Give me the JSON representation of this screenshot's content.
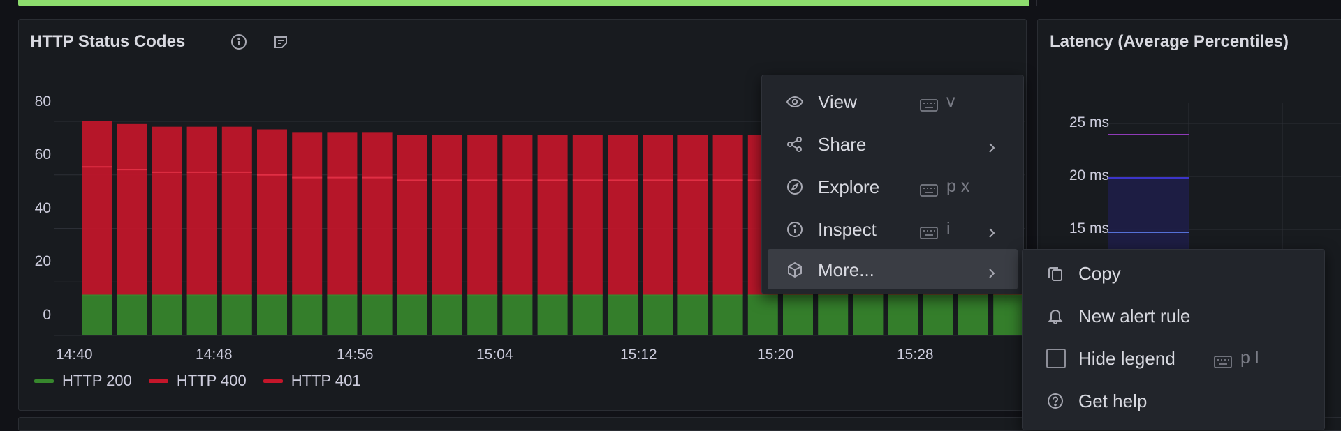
{
  "status_panel": {
    "title": "HTTP Status Codes",
    "info_icon": "info-circle-icon",
    "notes_icon": "note-icon",
    "y_ticks": [
      "80",
      "60",
      "40",
      "20",
      "0"
    ],
    "x_ticks": [
      "14:40",
      "14:48",
      "14:56",
      "15:04",
      "15:12",
      "15:20",
      "15:28"
    ],
    "legend": [
      {
        "label": "HTTP 200",
        "color": "#37872d"
      },
      {
        "label": "HTTP 400",
        "color": "#c4162a"
      },
      {
        "label": "HTTP 401",
        "color": "#c4162a"
      }
    ]
  },
  "latency_panel": {
    "title": "Latency (Average Percentiles)",
    "y_ticks": [
      "25 ms",
      "20 ms",
      "15 ms"
    ]
  },
  "context_menu": {
    "items": [
      {
        "label": "View",
        "icon": "eye-icon",
        "shortcut": "v",
        "submenu": false
      },
      {
        "label": "Share",
        "icon": "share-icon",
        "shortcut": "",
        "submenu": true
      },
      {
        "label": "Explore",
        "icon": "compass-icon",
        "shortcut": "p x",
        "submenu": false
      },
      {
        "label": "Inspect",
        "icon": "info-circle-icon",
        "shortcut": "i",
        "submenu": true
      },
      {
        "label": "More...",
        "icon": "cube-icon",
        "shortcut": "",
        "submenu": true
      }
    ]
  },
  "more_submenu": {
    "items": [
      {
        "label": "Copy",
        "icon": "copy-icon",
        "shortcut": ""
      },
      {
        "label": "New alert rule",
        "icon": "bell-icon",
        "shortcut": ""
      },
      {
        "label": "Hide legend",
        "icon": "checkbox-icon",
        "shortcut": "p l"
      },
      {
        "label": "Get help",
        "icon": "question-circle-icon",
        "shortcut": ""
      }
    ]
  },
  "chart_data": {
    "type": "bar",
    "stacked": true,
    "categories": [
      "14:40",
      "14:42",
      "14:44",
      "14:46",
      "14:48",
      "14:50",
      "14:52",
      "14:54",
      "14:56",
      "14:58",
      "15:00",
      "15:02",
      "15:04",
      "15:06",
      "15:08",
      "15:10",
      "15:12",
      "15:14",
      "15:16",
      "15:18",
      "15:20",
      "15:22",
      "15:24",
      "15:26",
      "15:28",
      "15:30",
      "15:32",
      "15:34"
    ],
    "series": [
      {
        "name": "HTTP 200",
        "color": "#37872d",
        "values": [
          15,
          15,
          15,
          15,
          15,
          15,
          15,
          15,
          15,
          15,
          15,
          15,
          15,
          15,
          15,
          15,
          15,
          15,
          15,
          15,
          15,
          15,
          15,
          15,
          15,
          15,
          15,
          15
        ]
      },
      {
        "name": "HTTP 400",
        "color": "#c4162a",
        "values": [
          48,
          47,
          46,
          46,
          46,
          45,
          44,
          44,
          44,
          43,
          43,
          43,
          43,
          43,
          43,
          43,
          43,
          43,
          43,
          43,
          43,
          43,
          43,
          43,
          43,
          43,
          43,
          43
        ]
      },
      {
        "name": "HTTP 401",
        "color": "#c4162a",
        "values": [
          17,
          17,
          17,
          17,
          17,
          17,
          17,
          17,
          17,
          17,
          17,
          17,
          17,
          17,
          17,
          17,
          17,
          17,
          17,
          17,
          17,
          17,
          17,
          17,
          17,
          17,
          17,
          17
        ]
      }
    ],
    "ylim": [
      0,
      80
    ],
    "grid": true,
    "legend_position": "bottom-left"
  }
}
